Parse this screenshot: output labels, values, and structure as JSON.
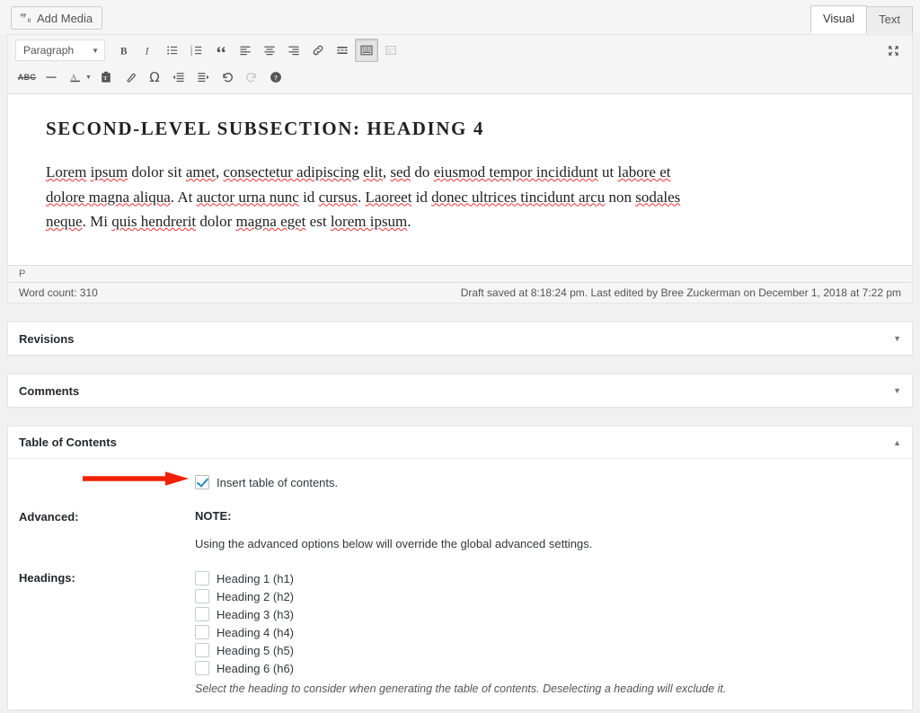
{
  "mediabar": {
    "add_media_label": "Add Media"
  },
  "editor_tabs": [
    {
      "label": "Visual",
      "active": true
    },
    {
      "label": "Text",
      "active": false
    }
  ],
  "toolbar": {
    "format_select_value": "Paragraph",
    "row1": [
      {
        "name": "bold-icon",
        "title": "Bold"
      },
      {
        "name": "italic-icon",
        "title": "Italic"
      },
      {
        "name": "bulleted-list-icon",
        "title": "Bulleted list"
      },
      {
        "name": "numbered-list-icon",
        "title": "Numbered list"
      },
      {
        "name": "blockquote-icon",
        "title": "Blockquote"
      },
      {
        "name": "align-left-icon",
        "title": "Align left"
      },
      {
        "name": "align-center-icon",
        "title": "Align center"
      },
      {
        "name": "align-right-icon",
        "title": "Align right"
      },
      {
        "name": "link-icon",
        "title": "Insert/edit link"
      },
      {
        "name": "read-more-icon",
        "title": "Insert Read More tag"
      },
      {
        "name": "toolbar-toggle-icon",
        "title": "Toolbar Toggle"
      },
      {
        "name": "page-break-icon",
        "title": "Page break"
      }
    ],
    "row2": [
      {
        "name": "strikethrough-icon",
        "title": "Strikethrough",
        "glyph": "ABC"
      },
      {
        "name": "horizontal-line-icon",
        "title": "Horizontal line"
      },
      {
        "name": "text-color-icon",
        "title": "Text color"
      },
      {
        "name": "paste-as-text-icon",
        "title": "Paste as text"
      },
      {
        "name": "clear-formatting-icon",
        "title": "Clear formatting"
      },
      {
        "name": "special-character-icon",
        "title": "Special character",
        "glyph": "Ω"
      },
      {
        "name": "decrease-indent-icon",
        "title": "Decrease indent"
      },
      {
        "name": "increase-indent-icon",
        "title": "Increase indent"
      },
      {
        "name": "undo-icon",
        "title": "Undo"
      },
      {
        "name": "redo-icon",
        "title": "Redo"
      },
      {
        "name": "keyboard-shortcuts-icon",
        "title": "Keyboard shortcuts"
      }
    ],
    "fullscreen_icon": "distraction-free-icon"
  },
  "document": {
    "heading": "SECOND-LEVEL SUBSECTION: HEADING 4",
    "paragraph_parts": [
      {
        "t": "Lorem",
        "sp": true
      },
      {
        "t": " ",
        "sp": false
      },
      {
        "t": "ipsum",
        "sp": true
      },
      {
        "t": " dolor sit ",
        "sp": false
      },
      {
        "t": "amet",
        "sp": true
      },
      {
        "t": ", ",
        "sp": false
      },
      {
        "t": "consectetur adipiscing",
        "sp": true
      },
      {
        "t": " ",
        "sp": false
      },
      {
        "t": "elit",
        "sp": true
      },
      {
        "t": ", ",
        "sp": false
      },
      {
        "t": "sed",
        "sp": true
      },
      {
        "t": " do ",
        "sp": false
      },
      {
        "t": "eiusmod tempor incididunt",
        "sp": true
      },
      {
        "t": " ut ",
        "sp": false
      },
      {
        "t": "labore et dolore magna aliqua",
        "sp": true
      },
      {
        "t": ". At ",
        "sp": false
      },
      {
        "t": "auctor urna nunc",
        "sp": true
      },
      {
        "t": " id ",
        "sp": false
      },
      {
        "t": "cursus",
        "sp": true
      },
      {
        "t": ". ",
        "sp": false
      },
      {
        "t": "Laoreet",
        "sp": true
      },
      {
        "t": " id ",
        "sp": false
      },
      {
        "t": "donec ultrices tincidunt arcu",
        "sp": true
      },
      {
        "t": " non ",
        "sp": false
      },
      {
        "t": "sodales neque",
        "sp": true
      },
      {
        "t": ". Mi ",
        "sp": false
      },
      {
        "t": "quis hendrerit",
        "sp": true
      },
      {
        "t": " dolor ",
        "sp": false
      },
      {
        "t": "magna eget",
        "sp": true
      },
      {
        "t": " est ",
        "sp": false
      },
      {
        "t": "lorem ipsum",
        "sp": true
      },
      {
        "t": ".",
        "sp": false
      }
    ],
    "paragraph_plain": "Lorem ipsum dolor sit amet, consectetur adipiscing elit, sed do eiusmod tempor incididunt ut labore et dolore magna aliqua. At auctor urna nunc id cursus. Laoreet id donec ultrices tincidunt arcu non sodales neque. Mi quis hendrerit dolor magna eget est lorem ipsum."
  },
  "statusbar": {
    "element_path": "P",
    "word_count": "Word count: 310",
    "save_status": "Draft saved at 8:18:24 pm. Last edited by Bree Zuckerman on December 1, 2018 at 7:22 pm"
  },
  "panels": [
    {
      "title": "Revisions",
      "expanded": false,
      "toggle_glyph": "▼"
    },
    {
      "title": "Comments",
      "expanded": false,
      "toggle_glyph": "▼"
    },
    {
      "title": "Table of Contents",
      "expanded": true,
      "toggle_glyph": "▲"
    }
  ],
  "toc_panel": {
    "insert_toc": {
      "label": "Insert table of contents.",
      "checked": true
    },
    "advanced": {
      "label": "Advanced:",
      "note_title": "NOTE:",
      "note_text": "Using the advanced options below will override the global advanced settings."
    },
    "headings": {
      "label": "Headings:",
      "items": [
        {
          "label": "Heading 1 (h1)",
          "checked": false
        },
        {
          "label": "Heading 2 (h2)",
          "checked": false
        },
        {
          "label": "Heading 3 (h3)",
          "checked": false
        },
        {
          "label": "Heading 4 (h4)",
          "checked": false
        },
        {
          "label": "Heading 5 (h5)",
          "checked": false
        },
        {
          "label": "Heading 6 (h6)",
          "checked": false
        }
      ],
      "description": "Select the heading to consider when generating the table of contents. Deselecting a heading will exclude it."
    }
  },
  "annotation": {
    "arrow_name": "red-pointer-arrow",
    "color": "#f02000"
  },
  "colors": {
    "page_background": "#f1f1f1",
    "panel_background": "#ffffff",
    "toolbar_background": "#f5f5f5",
    "checkbox_accent": "#1e8cbe",
    "annotation_red": "#f02000",
    "spellcheck_underline": "#ee3333"
  }
}
